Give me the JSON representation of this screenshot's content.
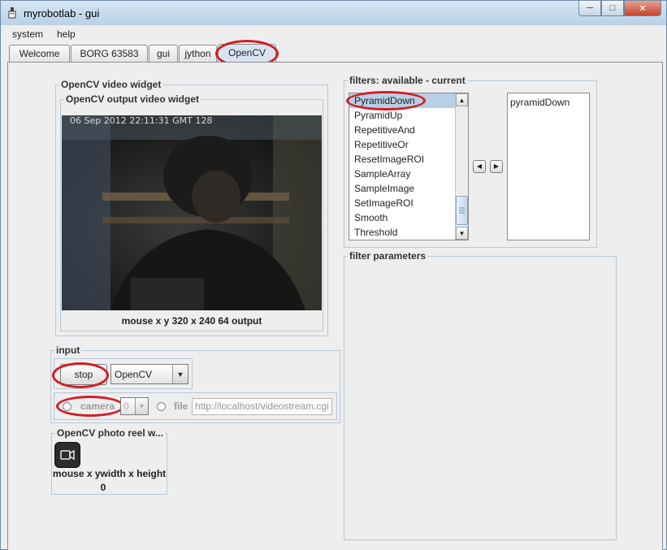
{
  "window": {
    "title": "myrobotlab - gui"
  },
  "menu": {
    "system": "system",
    "help": "help"
  },
  "tabs": [
    {
      "label": "Welcome"
    },
    {
      "label": "BORG 63583"
    },
    {
      "label": "gui"
    },
    {
      "label": "jython"
    },
    {
      "label": "OpenCV"
    }
  ],
  "video_widget": {
    "outer_title": "OpenCV  video widget",
    "inner_title": "OpenCV output video widget",
    "timestamp": "06 Sep 2012 22:11:31 GMT 128",
    "status": "mouse x y  320 x 240  64  output"
  },
  "input": {
    "title": "input",
    "stop_label": "stop",
    "source_selected": "OpenCV",
    "camera_label": "camera",
    "camera_index": "0",
    "file_label": "file",
    "file_placeholder": "http://localhost/videostream.cgi"
  },
  "photo_reel": {
    "title": "OpenCV  photo reel w...",
    "status": "mouse x ywidth x height",
    "count": "0"
  },
  "filters": {
    "title": "filters: available - current",
    "available": [
      "PyramidDown",
      "PyramidUp",
      "RepetitiveAnd",
      "RepetitiveOr",
      "ResetImageROI",
      "SampleArray",
      "SampleImage",
      "SetImageROI",
      "Smooth",
      "Threshold"
    ],
    "current": [
      "pyramidDown"
    ],
    "selected": "PyramidDown"
  },
  "filter_params": {
    "title": "filter parameters"
  },
  "colors": {
    "highlight_oval": "#d31c24",
    "selection": "#b8cfe5"
  }
}
